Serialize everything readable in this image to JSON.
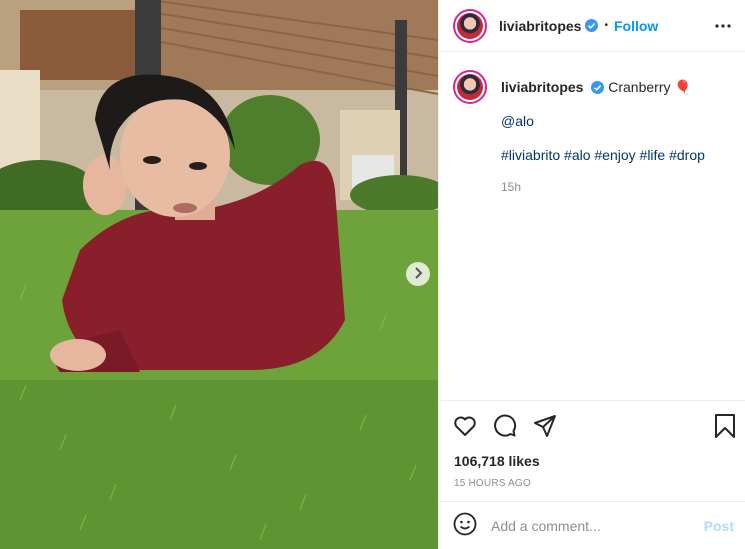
{
  "post": {
    "username": "liviabritopes",
    "follow_label": "Follow",
    "dot": "•",
    "more_icon": "more-horizontal-icon",
    "caption": {
      "text": "Cranberry",
      "emoji": "🎈",
      "mention": "@alo",
      "hashtags": "#liviabrito #alo #enjoy #life #drop",
      "age": "15h"
    },
    "likes": "106,718 likes",
    "posted": "15 HOURS AGO",
    "comment": {
      "placeholder": "Add a comment...",
      "post_label": "Post"
    },
    "icons": [
      "heart-icon",
      "comment-icon",
      "share-icon",
      "bookmark-icon",
      "emoji-icon",
      "chevron-right-icon",
      "verified-icon"
    ],
    "colors": {
      "follow": "#0095f6",
      "verified": "#3897f0",
      "link": "#00376b",
      "muted": "#8e8e8e",
      "post_disabled": "#b3dbff"
    }
  }
}
